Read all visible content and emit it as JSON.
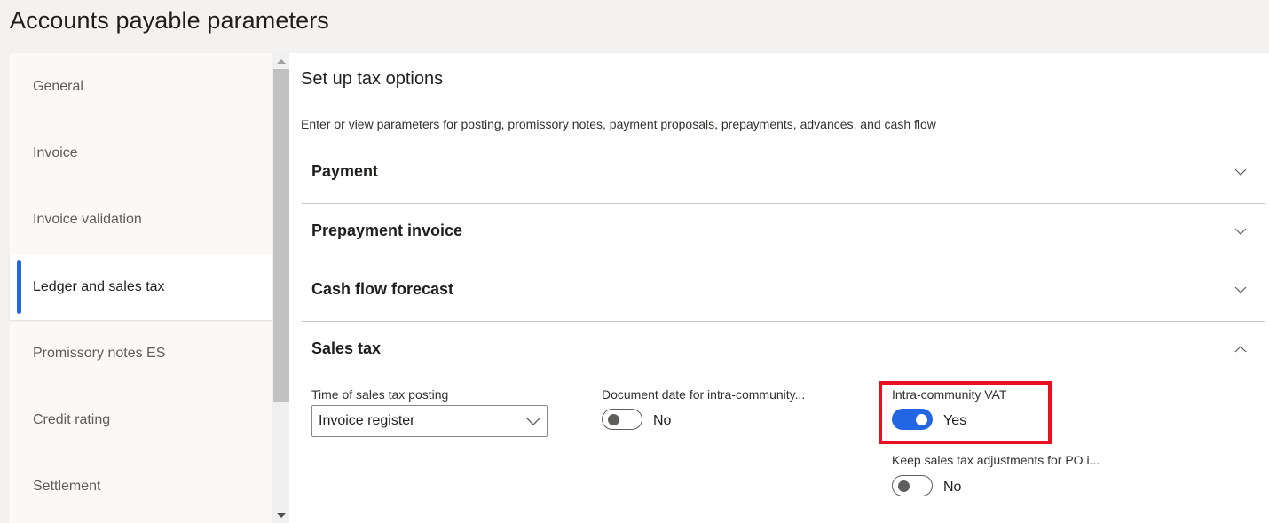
{
  "page": {
    "title": "Accounts payable parameters"
  },
  "sidebar": {
    "items": [
      {
        "label": "General",
        "active": false
      },
      {
        "label": "Invoice",
        "active": false
      },
      {
        "label": "Invoice validation",
        "active": false
      },
      {
        "label": "Ledger and sales tax",
        "active": true
      },
      {
        "label": "Promissory notes ES",
        "active": false
      },
      {
        "label": "Credit rating",
        "active": false
      },
      {
        "label": "Settlement",
        "active": false
      }
    ]
  },
  "main": {
    "title": "Set up tax options",
    "description": "Enter or view parameters for posting, promissory notes, payment proposals, prepayments, advances, and cash flow",
    "fasttabs": [
      {
        "label": "Payment",
        "expanded": false,
        "icon": "chevron-down-icon"
      },
      {
        "label": "Prepayment invoice",
        "expanded": false,
        "icon": "chevron-down-icon"
      },
      {
        "label": "Cash flow forecast",
        "expanded": false,
        "icon": "chevron-down-icon"
      },
      {
        "label": "Sales tax",
        "expanded": true,
        "icon": "chevron-up-icon"
      }
    ],
    "sales_tax": {
      "time_of_posting": {
        "label": "Time of sales tax posting",
        "value": "Invoice register"
      },
      "document_date": {
        "label": "Document date for intra-community...",
        "value": "No",
        "on": false
      },
      "intra_community_vat": {
        "label": "Intra-community VAT",
        "value": "Yes",
        "on": true
      },
      "keep_adjustments": {
        "label": "Keep sales tax adjustments for PO i...",
        "value": "No",
        "on": false
      }
    }
  },
  "colors": {
    "accent": "#2266e3",
    "highlight": "#e81123",
    "toggle_off": "#605e5c"
  }
}
